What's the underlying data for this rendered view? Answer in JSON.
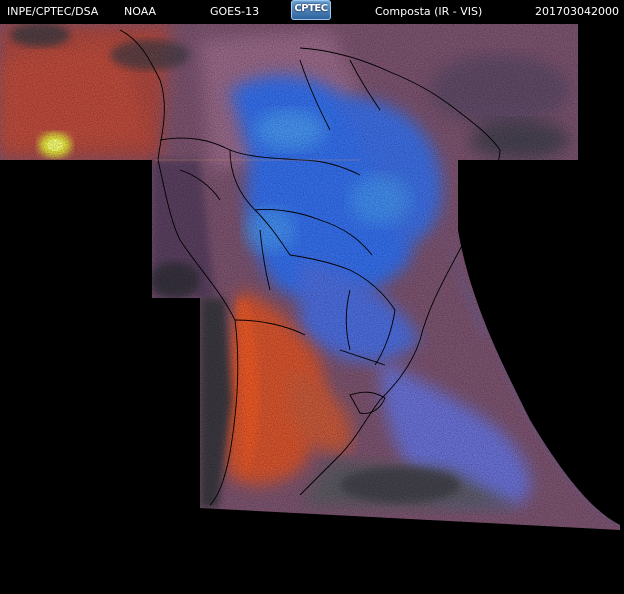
{
  "header": {
    "left_label": "INPE/CPTEC/DSA",
    "agency": "NOAA",
    "satellite": "GOES-13",
    "logo_text": "CPTEC",
    "product": "Composta (IR - VIS)",
    "timestamp": "201703042000"
  },
  "colors": {
    "background": "#000000",
    "cold_clouds": "#2f6cf0",
    "warm_land": "#e0502a",
    "mixed": "#8a5a7a",
    "hot_spot": "#e6f53a",
    "boundaries": "#000000"
  }
}
